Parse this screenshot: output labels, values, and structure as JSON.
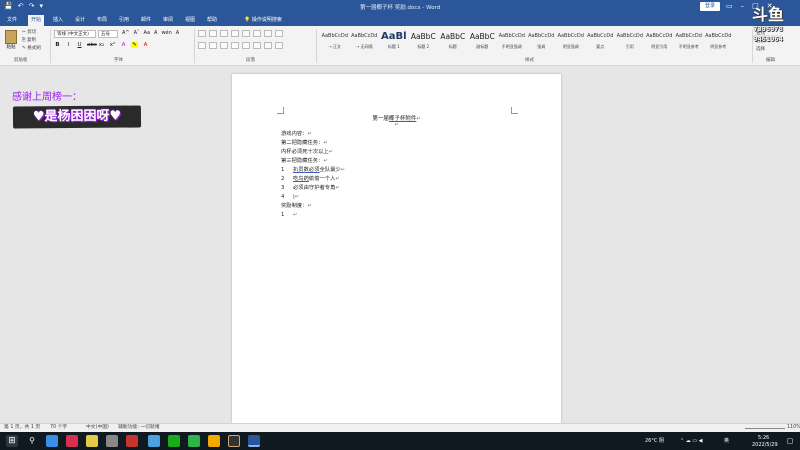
{
  "titlebar": {
    "quick_access": [
      "💾",
      "↶",
      "↷",
      "▾"
    ],
    "title": "第一届椰子杯 奖励.docx - Word",
    "login": "登录",
    "win_buttons": [
      "▭",
      "–",
      "□",
      "✕"
    ]
  },
  "tabs": [
    {
      "label": "文件"
    },
    {
      "label": "开始"
    },
    {
      "label": "插入"
    },
    {
      "label": "设计"
    },
    {
      "label": "布局"
    },
    {
      "label": "引用"
    },
    {
      "label": "邮件"
    },
    {
      "label": "审阅"
    },
    {
      "label": "视图"
    },
    {
      "label": "帮助"
    }
  ],
  "tell_me": "操作说明搜索",
  "ribbon": {
    "paste_label": "粘贴",
    "clipboard_items": [
      "✂ 剪切",
      "⎘ 复制",
      "✎ 格式刷"
    ],
    "font_name": "等线 (中文正文)",
    "font_size": "五号",
    "format_buttons": [
      "B",
      "I",
      "U",
      "abc",
      "x₂",
      "x²"
    ],
    "font_row2": [
      "A^",
      "Aˇ",
      "Aa",
      "A",
      "wén",
      "A"
    ],
    "groups": {
      "clipboard": "剪贴板",
      "font": "字体",
      "paragraph": "段落",
      "styles": "样式",
      "editing": "编辑"
    },
    "styles": [
      {
        "sample": "AaBbCcDd",
        "name": "→ 正文",
        "kind": "normal"
      },
      {
        "sample": "AaBbCcDd",
        "name": "→ 无间隔",
        "kind": "normal"
      },
      {
        "sample": "AaBl",
        "name": "标题 1",
        "kind": "big"
      },
      {
        "sample": "AaBbC",
        "name": "标题 2",
        "kind": "mid"
      },
      {
        "sample": "AaBbC",
        "name": "标题",
        "kind": "mid"
      },
      {
        "sample": "AaBbC",
        "name": "副标题",
        "kind": "mid"
      },
      {
        "sample": "AaBbCcDd",
        "name": "不明显强调",
        "kind": "normal"
      },
      {
        "sample": "AaBbCcDd",
        "name": "强调",
        "kind": "normal"
      },
      {
        "sample": "AaBbCcDd",
        "name": "明显强调",
        "kind": "normal"
      },
      {
        "sample": "AaBbCcDd",
        "name": "要点",
        "kind": "normal"
      },
      {
        "sample": "AaBbCcDd",
        "name": "引用",
        "kind": "normal"
      },
      {
        "sample": "AaBbCcDd",
        "name": "明显引用",
        "kind": "normal"
      },
      {
        "sample": "AaBbCcDd",
        "name": "不明显参考",
        "kind": "normal"
      },
      {
        "sample": "AaBbCcDd",
        "name": "明显参考",
        "kind": "normal"
      }
    ],
    "editing_items": [
      "查找",
      "替换",
      "选择"
    ]
  },
  "document": {
    "title_plain": "第一届",
    "title_ul": "椰子杯附件",
    "lines": [
      {
        "num": "",
        "text": "游戏内容：",
        "ul": ""
      },
      {
        "num": "",
        "text": "第二把隐藏任务：",
        "ul": ""
      },
      {
        "num": "",
        "text": "内杯必须死十次以上",
        "ul": ""
      },
      {
        "num": "",
        "text": "第三把隐藏任务：",
        "ul": ""
      },
      {
        "num": "1",
        "text": "全队最少",
        "ul": "扒员数必须"
      },
      {
        "num": "2",
        "text": "偷偷一个人",
        "ul": "吃鸟药"
      },
      {
        "num": "3",
        "text": "必须由守护者专角",
        "ul": ""
      },
      {
        "num": "4",
        "text": "|",
        "ul": ""
      },
      {
        "num": "",
        "text": "奖励制度：",
        "ul": ""
      },
      {
        "num": "1",
        "text": "",
        "ul": ""
      }
    ]
  },
  "overlay": {
    "thanks": "感谢上周榜一：",
    "banner": "♥是杨困困呀♥",
    "logo_l1": "斗鱼",
    "logo_l2": "7396978",
    "logo_l3": "9461064"
  },
  "statusbar": {
    "page": "第 1 页，共 1 页",
    "words": "70 个字",
    "lang": "中文(中国)",
    "accessibility": "辅助功能: 一切就绪",
    "zoom": "110%"
  },
  "taskbar": {
    "weather": "26°C 阴",
    "time": "5:26",
    "date": "2022/5/29",
    "lang_indicator": "英"
  },
  "colors": {
    "accent": "#2b579a",
    "overlay_purple": "#a020f0"
  }
}
